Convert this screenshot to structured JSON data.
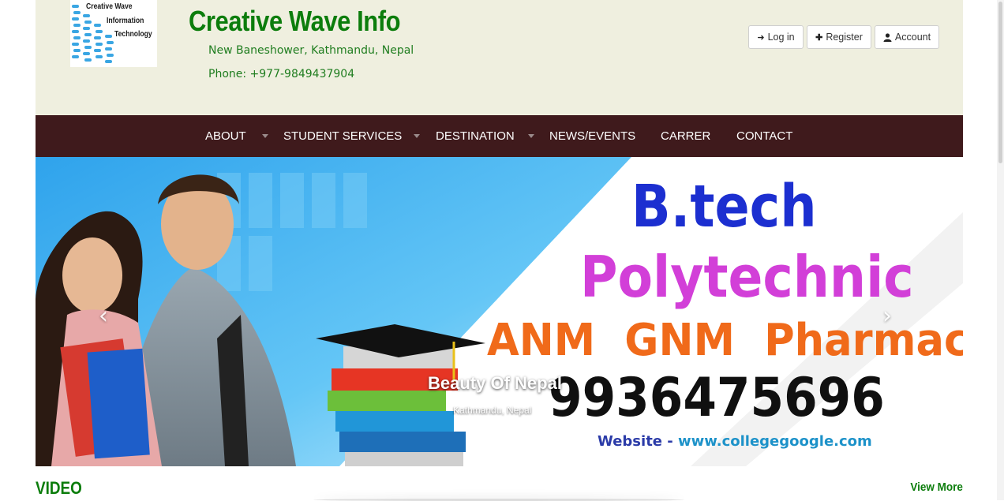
{
  "header": {
    "logo": {
      "line1": "Creative Wave",
      "line2": "Information",
      "line3": "Technology"
    },
    "title": "Creative Wave Info",
    "address": "New Baneshower, Kathmandu, Nepal",
    "phone": "Phone: +977-9849437904",
    "auth": [
      {
        "label": "Log in",
        "icon": "login-icon"
      },
      {
        "label": "Register",
        "icon": "plus-icon"
      },
      {
        "label": "Account",
        "icon": "user-icon"
      }
    ]
  },
  "nav": {
    "items": [
      {
        "label": "ABOUT",
        "has_dropdown": true
      },
      {
        "label": "STUDENT SERVICES",
        "has_dropdown": true
      },
      {
        "label": "DESTINATION",
        "has_dropdown": true
      },
      {
        "label": "NEWS/EVENTS",
        "has_dropdown": false
      },
      {
        "label": "CARRER",
        "has_dropdown": false
      },
      {
        "label": "CONTACT",
        "has_dropdown": false
      }
    ]
  },
  "banner": {
    "line1": "B.tech",
    "line2": "Polytechnic",
    "line3": "ANM   GNM   Pharmacy",
    "line4": "9936475696",
    "website_label": "Website - ",
    "website_url": "www.collegegoogle.com",
    "caption_title": "Beauty Of Nepal",
    "caption_sub": "Kathmandu, Nepal",
    "prev": "‹",
    "next": "›"
  },
  "section": {
    "heading": "VIDEO",
    "view_more": "View More"
  },
  "colors": {
    "brand_green": "#0c7d0c",
    "nav_bg": "#3f1a1c",
    "header_bg": "#efefdf"
  }
}
